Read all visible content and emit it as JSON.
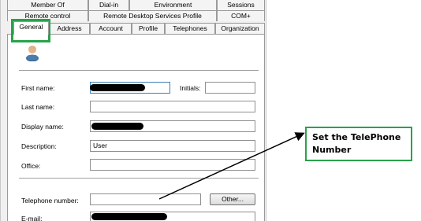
{
  "tabs_row1": [
    "Member Of",
    "Dial-in",
    "Environment",
    "Sessions"
  ],
  "tabs_row2": [
    "Remote control",
    "Remote Desktop Services Profile",
    "COM+"
  ],
  "tabs_row3": [
    "General",
    "Address",
    "Account",
    "Profile",
    "Telephones",
    "Organization"
  ],
  "form": {
    "first_name_label": "First name:",
    "initials_label": "Initials:",
    "last_name_label": "Last name:",
    "display_name_label": "Display name:",
    "description_label": "Description:",
    "description_value": "User",
    "office_label": "Office:",
    "telephone_label": "Telephone number:",
    "other_button": "Other...",
    "email_label": "E-mail:"
  },
  "annotation": {
    "text": "Set the TelePhone Number",
    "color": "#27a34a"
  },
  "icons": {
    "user": "user-icon"
  }
}
